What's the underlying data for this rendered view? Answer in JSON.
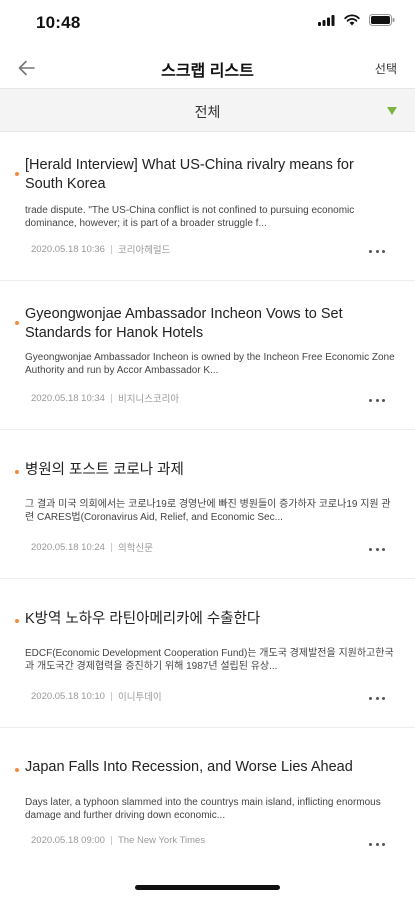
{
  "status_bar": {
    "time": "10:48",
    "icons": [
      "signal-icon",
      "wifi-icon",
      "battery-icon"
    ]
  },
  "nav": {
    "back_icon": "arrow-left-icon",
    "title": "스크랩 리스트",
    "select_label": "선택"
  },
  "filter": {
    "selected": "전체",
    "arrow_icon": "triangle-down-icon",
    "arrow_color": "#7cb342"
  },
  "accent": {
    "dot_color": "#f08c3c"
  },
  "articles": [
    {
      "title": "[Herald Interview] What US-China rivalry means for South Korea",
      "summary": "trade dispute. \"The US-China conflict is not confined to pursuing economic dominance, however; it is part of a broader struggle f...",
      "date": "2020.05.18 10:36",
      "source": "코리아헤럴드"
    },
    {
      "title": "Gyeongwonjae Ambassador Incheon Vows to Set Standards for Hanok Hotels",
      "summary": "Gyeongwonjae Ambassador Incheon is owned by the Incheon Free Economic Zone Authority and run by Accor Ambassador K...",
      "date": "2020.05.18 10:34",
      "source": "비지니스코리아"
    },
    {
      "title": "병원의 포스트 코로나 과제",
      "summary": "그 결과 미국 의회에서는 코로나19로 경영난에 빠진 병원들이 증가하자 코로나19 지원 관련 CARES법(Coronavirus Aid, Relief, and Economic Sec...",
      "date": "2020.05.18 10:24",
      "source": "의학신문"
    },
    {
      "title": "K방역 노하우 라틴아메리카에 수출한다",
      "summary": "EDCF(Economic Development Cooperation Fund)는 개도국 경제발전을 지원하고한국과 개도국간 경제협력을 증진하기 위해 1987년 설립된 유상...",
      "date": "2020.05.18 10:10",
      "source": "이니투데이"
    },
    {
      "title": "Japan Falls Into Recession, and Worse Lies Ahead",
      "summary": "Days later, a typhoon slammed into the countrys main island, inflicting enormous damage and further driving down economic...",
      "date": "2020.05.18 09:00",
      "source": "The New York Times"
    }
  ]
}
